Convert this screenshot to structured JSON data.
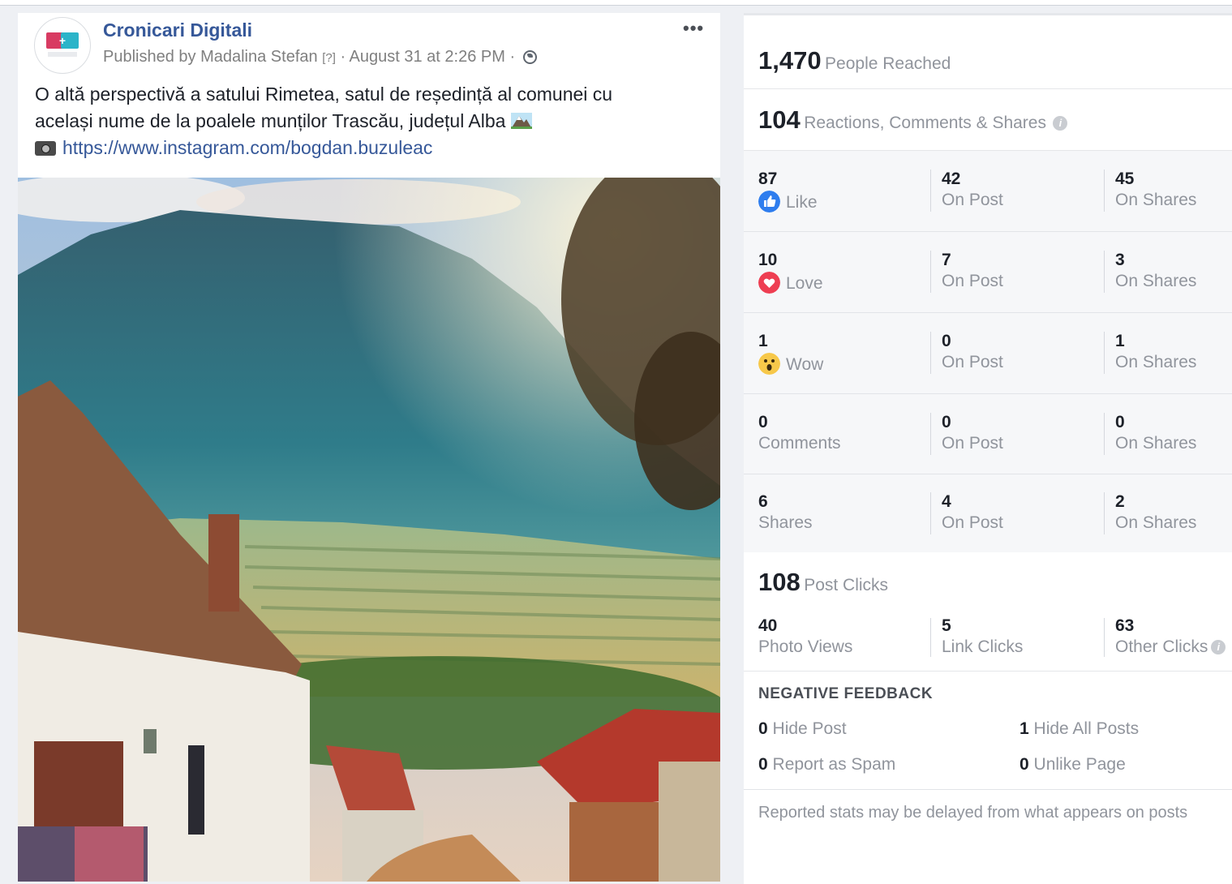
{
  "post": {
    "page_name": "Cronicari Digitali",
    "published_by": "Published by Madalina Stefan",
    "help_mark": "[?]",
    "date": "· August 31 at 2:26 PM ·",
    "text_line1": "O altă perspectivă a satului Rimetea, satul de reședință al comunei cu",
    "text_line2": "același nume de la poalele munților Trascău, județul Alba",
    "link": "https://www.instagram.com/bogdan.buzuleac",
    "more_label": "•••",
    "icons": [
      "globe-icon",
      "mountain-emoji",
      "camera-emoji",
      "more-icon"
    ]
  },
  "insights": {
    "reach": {
      "value": "1,470",
      "label": "People Reached"
    },
    "engagement": {
      "value": "104",
      "label": "Reactions, Comments & Shares"
    },
    "rows": [
      {
        "value": "87",
        "label": "Like",
        "icon": "like-icon",
        "on_post": "42",
        "on_shares": "45"
      },
      {
        "value": "10",
        "label": "Love",
        "icon": "love-icon",
        "on_post": "7",
        "on_shares": "3"
      },
      {
        "value": "1",
        "label": "Wow",
        "icon": "wow-icon",
        "on_post": "0",
        "on_shares": "1"
      },
      {
        "value": "0",
        "label": "Comments",
        "on_post": "0",
        "on_shares": "0"
      },
      {
        "value": "6",
        "label": "Shares",
        "on_post": "4",
        "on_shares": "2"
      }
    ],
    "on_post_label": "On Post",
    "on_shares_label": "On Shares",
    "clicks": {
      "value": "108",
      "label": "Post Clicks",
      "photo_views": "40",
      "photo_views_label": "Photo Views",
      "link_clicks": "5",
      "link_clicks_label": "Link Clicks",
      "other_clicks": "63",
      "other_clicks_label": "Other Clicks"
    },
    "negative": {
      "title": "NEGATIVE FEEDBACK",
      "hide_post": "0",
      "hide_post_label": "Hide Post",
      "hide_all": "1",
      "hide_all_label": "Hide All Posts",
      "spam": "0",
      "spam_label": "Report as Spam",
      "unlike": "0",
      "unlike_label": "Unlike Page"
    },
    "footer": "Reported stats may be delayed from what appears on posts",
    "info_mark": "i",
    "colors": {
      "like": "#2e7dee",
      "love": "#ee3e52",
      "wow": "#f7c84a",
      "link": "#365899"
    }
  }
}
